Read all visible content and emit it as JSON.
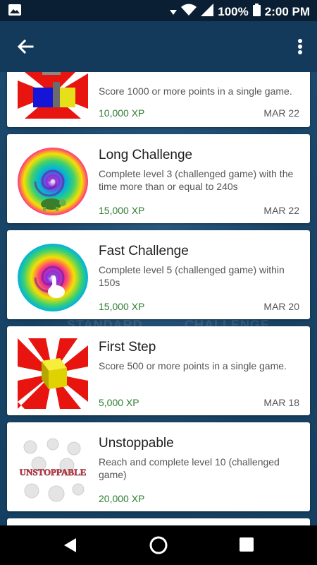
{
  "status": {
    "battery": "100%",
    "time": "2:00 PM"
  },
  "app_bar": {
    "back_icon": "arrow-back-icon",
    "menu_icon": "more-vert-icon"
  },
  "background": {
    "tab1": "STANDARD",
    "tab2": "CHALLENGE"
  },
  "achievements": [
    {
      "title": "",
      "description": "Score 1000 or more points in a single game.",
      "xp": "10,000 XP",
      "date": "MAR 22",
      "image": "cubes"
    },
    {
      "title": "Long Challenge",
      "description": "Complete level 3 (challenged game) with the time more than or equal to 240s",
      "xp": "15,000 XP",
      "date": "MAR 22",
      "image": "swirl-turtle"
    },
    {
      "title": "Fast Challenge",
      "description": "Complete level 5 (challenged game) within 150s",
      "xp": "15,000 XP",
      "date": "MAR 20",
      "image": "swirl-rabbit"
    },
    {
      "title": "First Step",
      "description": "Score 500 or more points in a single game.",
      "xp": "5,000 XP",
      "date": "MAR 18",
      "image": "cube-rays"
    },
    {
      "title": "Unstoppable",
      "description": "Reach and complete level 10 (challenged game)",
      "xp": "20,000 XP",
      "date": "",
      "image": "unstoppable"
    }
  ],
  "badge_text": "UNSTOPPABLE",
  "colors": {
    "xp": "#2e7d32",
    "app_bar": "#133a5b",
    "status_bar": "#0a1f33"
  }
}
